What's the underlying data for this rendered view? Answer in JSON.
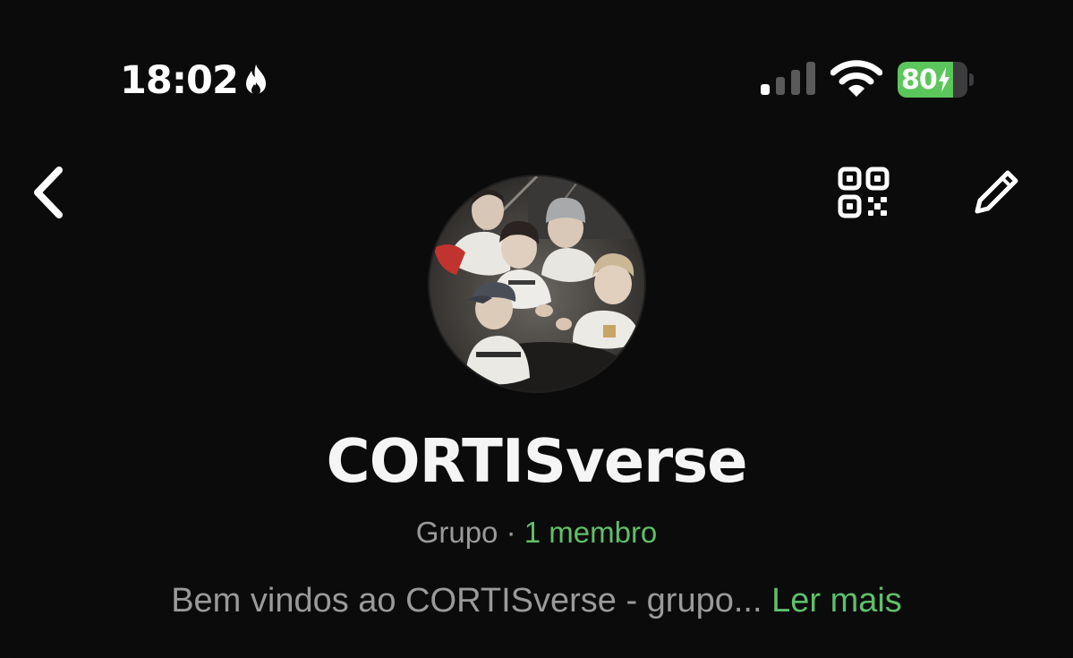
{
  "status_bar": {
    "time": "18:02",
    "time_badge_icon": "flame-icon",
    "signal_icon": "cellular-signal-icon",
    "wifi_icon": "wifi-icon",
    "battery_percent": "80",
    "battery_level": 0.8,
    "battery_charging": true,
    "battery_color": "#5bc65b"
  },
  "nav": {
    "back_icon": "chevron-left-icon",
    "qr_icon": "qr-code-icon",
    "edit_icon": "pencil-icon"
  },
  "group": {
    "avatar_description": "group photo",
    "name": "CORTISverse",
    "type_label": "Grupo",
    "separator": " · ",
    "members_label": "1 membro",
    "description": "Bem vindos ao CORTISverse - grupo...",
    "read_more_label": "Ler mais"
  },
  "colors": {
    "background": "#0b0b0b",
    "accent_green": "#5fbf6a",
    "secondary_text": "#9a9a9a"
  }
}
